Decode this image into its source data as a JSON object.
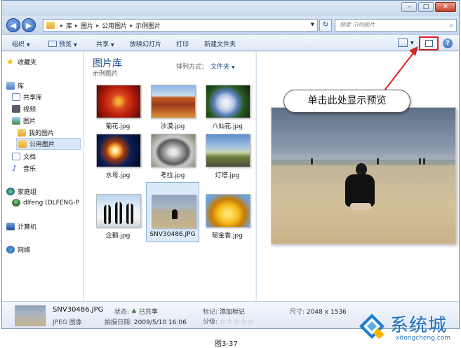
{
  "window": {
    "controls": [
      "–",
      "□",
      "✕"
    ]
  },
  "address": {
    "crumbs": [
      "库",
      "图片",
      "公用图片",
      "示例图片"
    ],
    "search_placeholder": "搜索 示例图片"
  },
  "toolbar": {
    "organize": "组织",
    "preview": "预览",
    "share": "共享",
    "slideshow": "放映幻灯片",
    "print": "打印",
    "new_folder": "新建文件夹"
  },
  "nav": {
    "favorites": "收藏夹",
    "libraries": "库",
    "public_library": "共享库",
    "videos": "视频",
    "pictures": "图片",
    "my_pictures": "我的图片",
    "public_pictures": "公用图片",
    "documents": "文档",
    "music": "音乐",
    "homegroup": "家庭组",
    "user": "dlfeng (DLFENG-P",
    "computer": "计算机",
    "network": "网络"
  },
  "library": {
    "title": "图片库",
    "subtitle": "示例图片",
    "arrange_label": "排列方式：",
    "arrange_value": "文件夹"
  },
  "files": [
    {
      "name": "菊花.jpg"
    },
    {
      "name": "沙漠.jpg"
    },
    {
      "name": "八仙花.jpg"
    },
    {
      "name": "水母.jpg"
    },
    {
      "name": "考拉.jpg"
    },
    {
      "name": "灯塔.jpg"
    },
    {
      "name": "企鹅.jpg"
    },
    {
      "name": "SNV30486.JPG"
    },
    {
      "name": "郁金香.jpg"
    }
  ],
  "callout": "单击此处显示预览",
  "details": {
    "file_name": "SNV30486.JPG",
    "file_type": "JPEG 图像",
    "status_label": "状态:",
    "status_value": "已共享",
    "date_label": "拍摄日期:",
    "date_value": "2009/5/10 16:06",
    "tags_label": "标记:",
    "tags_value": "添加标记",
    "rating_label": "分级:",
    "rating_stars": "☆☆☆☆☆",
    "size_label": "尺寸:",
    "size_value": "2048 x 1536"
  },
  "caption": "图3-37",
  "watermark": {
    "brand": "系统城",
    "url": "xitongcheng.com"
  },
  "colors": {
    "accent": "#1e4d8c",
    "highlight_border": "#dd2222",
    "selection": "#dbe9f8"
  }
}
